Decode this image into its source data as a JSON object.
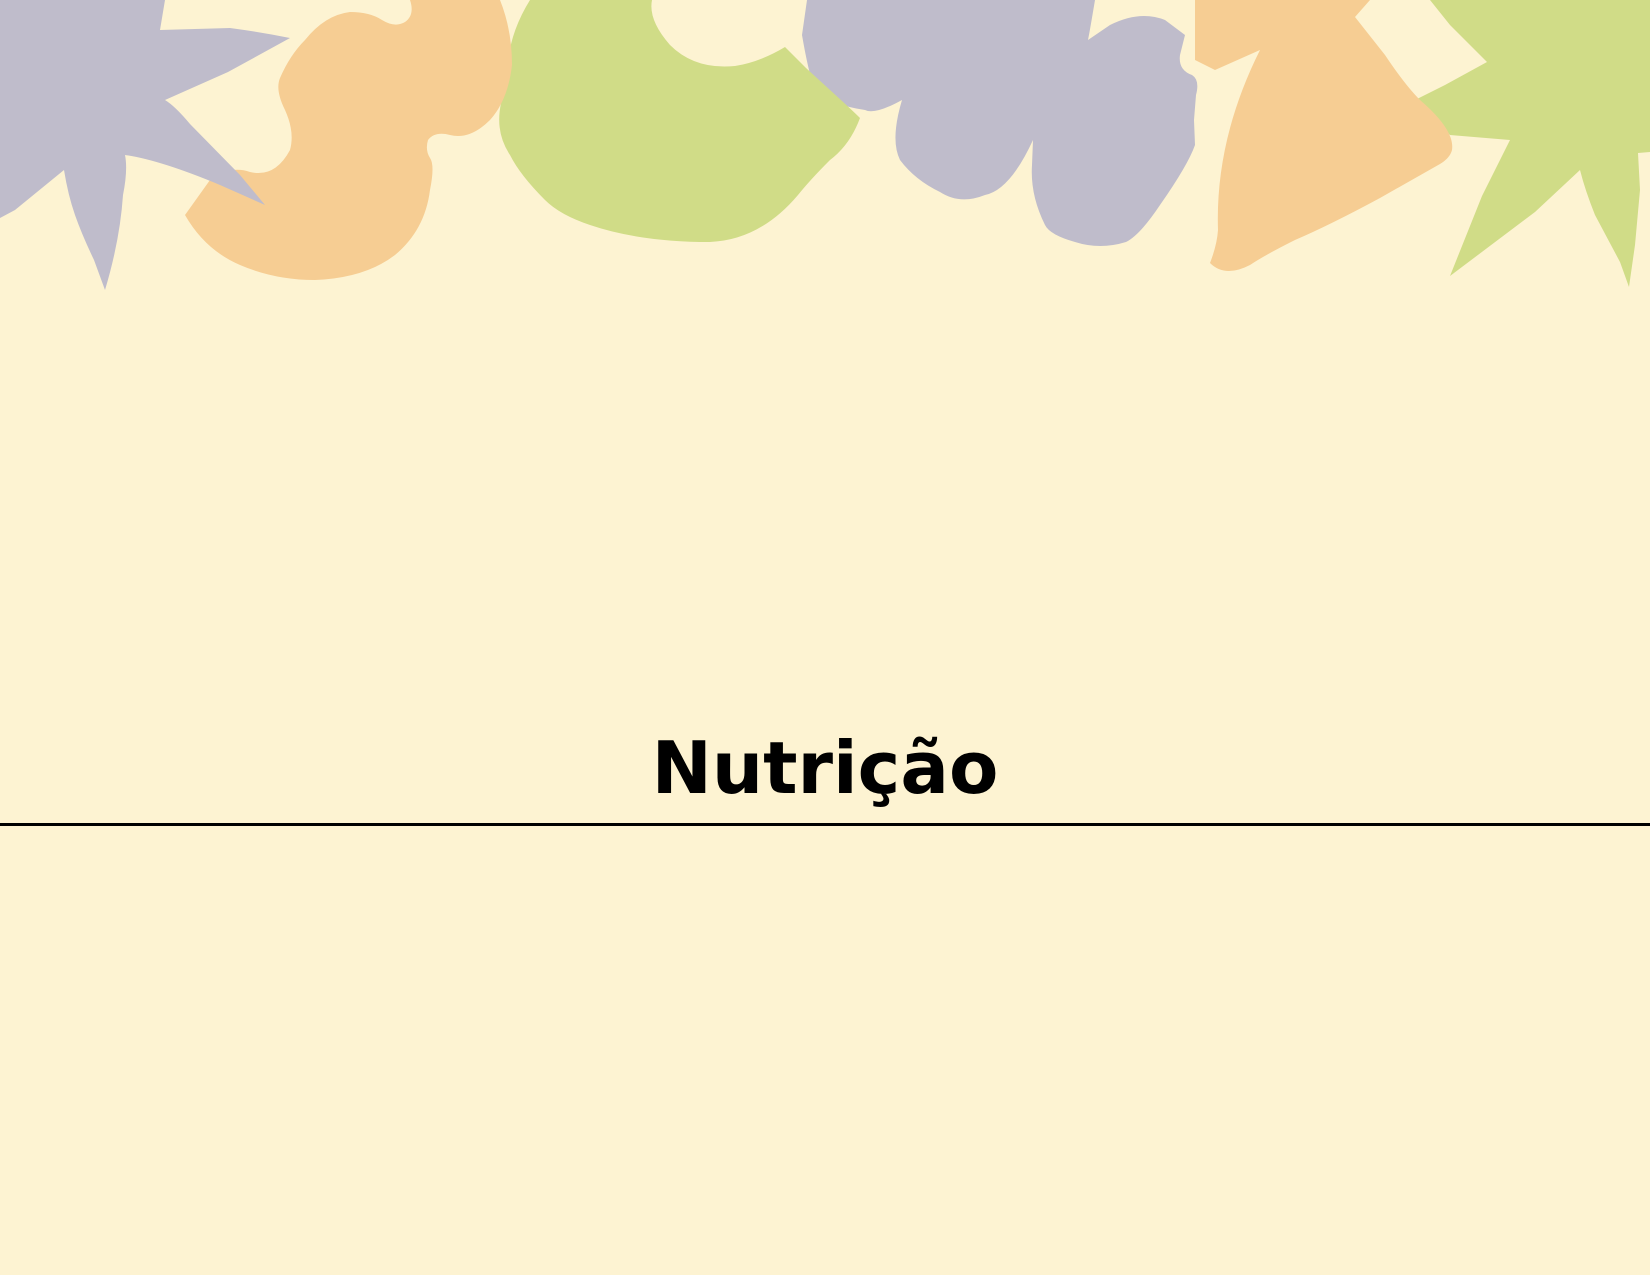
{
  "document": {
    "title": "Nutrição"
  },
  "colors": {
    "background": "#fdf3d2",
    "lavender": "#bfbccb",
    "peach": "#f6cd93",
    "lime": "#d0dc87",
    "text": "#000000"
  }
}
